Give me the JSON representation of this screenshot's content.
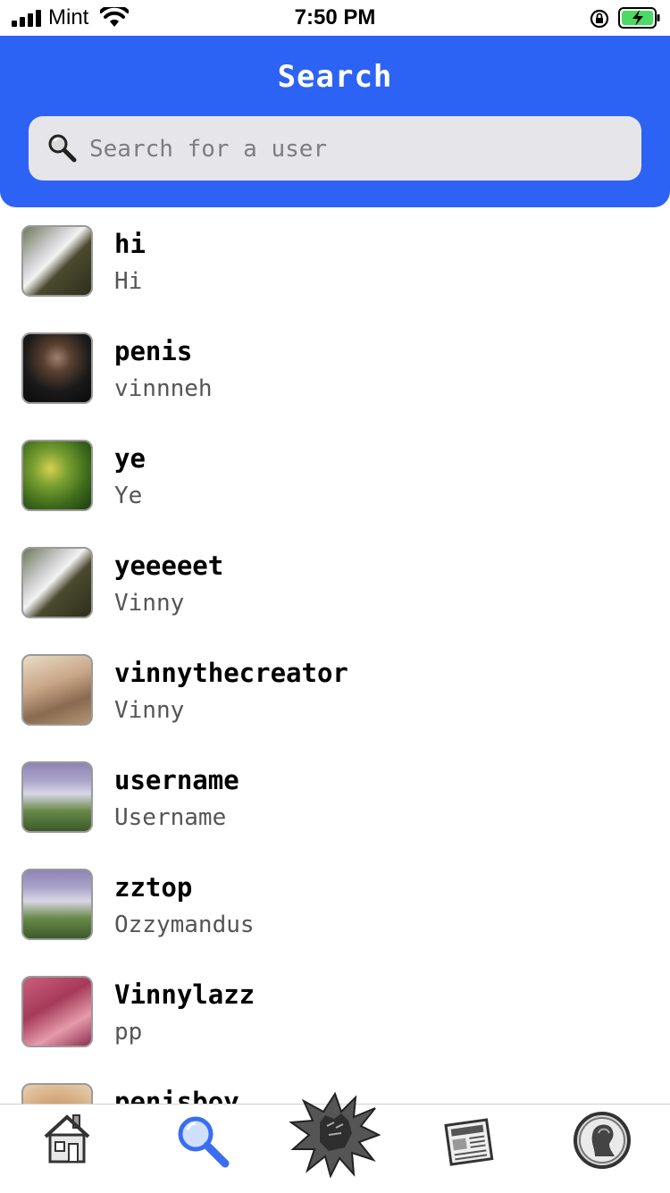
{
  "status_bar": {
    "carrier": "Mint",
    "time": "7:50 PM"
  },
  "header": {
    "title": "Search"
  },
  "search": {
    "placeholder": "Search for a user"
  },
  "users": [
    {
      "username": "hi",
      "display_name": "Hi"
    },
    {
      "username": "penis",
      "display_name": "vinnneh"
    },
    {
      "username": "ye",
      "display_name": "Ye"
    },
    {
      "username": "yeeeeet",
      "display_name": "Vinny"
    },
    {
      "username": "vinnythecreator",
      "display_name": "Vinny"
    },
    {
      "username": "username",
      "display_name": "Username"
    },
    {
      "username": "zztop",
      "display_name": "Ozzymandus"
    },
    {
      "username": "Vinnylazz",
      "display_name": "pp"
    },
    {
      "username": "penisboy",
      "display_name": ""
    }
  ],
  "tabs": [
    {
      "icon": "house-icon",
      "active": false
    },
    {
      "icon": "magnifier-icon",
      "active": true
    },
    {
      "icon": "high-five-icon",
      "active": false
    },
    {
      "icon": "newspaper-icon",
      "active": false
    },
    {
      "icon": "profile-icon",
      "active": false
    }
  ],
  "colors": {
    "header": "#2d63f4",
    "search_field": "#e6e6ea",
    "active_tab": "#3a6df0",
    "battery": "#4cd964"
  }
}
